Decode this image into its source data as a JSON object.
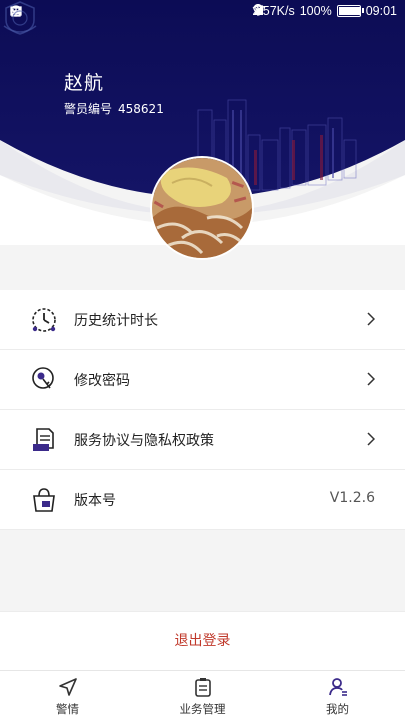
{
  "status_bar": {
    "speed": "2.57K/s",
    "battery": "100%",
    "time": "09:01",
    "battery_level": 1.0
  },
  "profile": {
    "name": "赵航",
    "officer_id_label": "警员编号",
    "officer_id": "458621"
  },
  "menu": {
    "items": [
      {
        "label": "历史统计时长",
        "icon": "clock-stats-icon"
      },
      {
        "label": "修改密码",
        "icon": "key-icon"
      },
      {
        "label": "服务协议与隐私权政策",
        "icon": "document-icon"
      },
      {
        "label": "版本号",
        "icon": "bag-icon",
        "value": "V1.2.6"
      }
    ]
  },
  "logout_label": "退出登录",
  "bottom_nav": {
    "items": [
      {
        "label": "警情",
        "icon": "send-icon"
      },
      {
        "label": "业务管理",
        "icon": "clipboard-icon"
      },
      {
        "label": "我的",
        "icon": "user-icon"
      }
    ]
  },
  "colors": {
    "header_bg": "#10105a",
    "logout": "#c0392b",
    "accent": "#3b2a8a"
  }
}
